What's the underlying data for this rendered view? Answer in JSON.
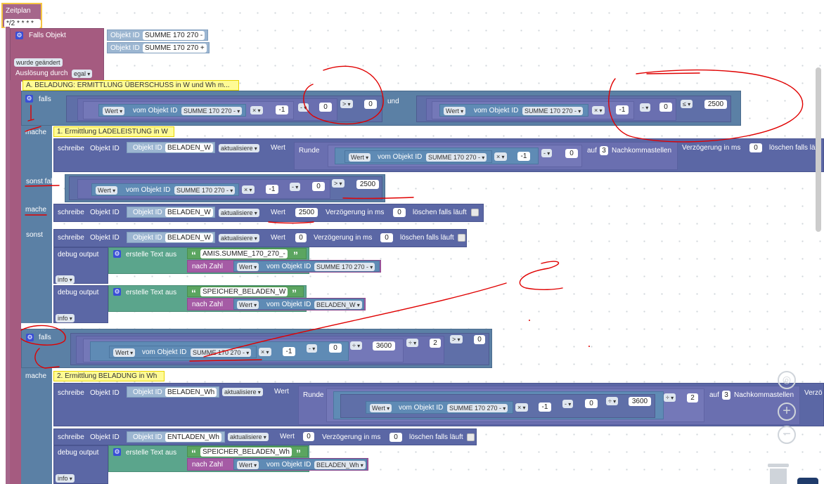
{
  "schedule": {
    "label": "Zeitplan",
    "cron": "*/2 * * * *"
  },
  "trigger": {
    "title": "Falls Objekt",
    "id_label": "Objekt ID",
    "obj1": "SUMME 170 270 -",
    "obj2": "SUMME 170 270 +",
    "changed": "wurde geändert",
    "by_label": "Auslösung durch",
    "by": "egal"
  },
  "commentA": "A. BELADUNG: ERMITTLUNG ÜBERSCHUSS in W und Wh m...",
  "kw": {
    "falls": "falls",
    "mache": "mache",
    "sonst_falls": "sonst falls",
    "sonst": "sonst",
    "und": "und",
    "wert": "Wert",
    "vom_obj": "vom Objekt ID",
    "schreibe": "schreibe",
    "objekt_id": "Objekt ID",
    "aktualisiere": "aktualisiere",
    "wert2": "Wert",
    "runde": "Runde",
    "auf": "auf",
    "nachkomma": "Nachkommastellen",
    "verzoegerung": "Verzögerung in ms",
    "loeschen": "löschen falls läuft",
    "debug": "debug output",
    "erstelle": "erstelle Text aus",
    "nach_zahl": "nach Zahl",
    "info": "info",
    "verz_cut": "Verzö",
    "loeschen_cut": "löschen falls läu"
  },
  "ops": {
    "mult": "×",
    "minus": "-",
    "gt": ">",
    "le": "≤",
    "div": "÷"
  },
  "nums": {
    "m1": "-1",
    "z": "0",
    "n2500": "2500",
    "n3": "3",
    "n3600": "3600",
    "n2": "2"
  },
  "objs": {
    "summe_minus": "SUMME 170 270 -",
    "beladen_w": "BELADEN_W",
    "beladen_wh": "BELADEN_Wh",
    "entladen_wh": "ENTLADEN_Wh"
  },
  "comment1": "1. Ermittlung LADELEISTUNG in W",
  "comment2": "2. Ermittlung BELADUNG in Wh",
  "strings": {
    "amis": "AMIS.SUMME_170_270_-",
    "speicher_w": "SPEICHER_BELADEN_W",
    "speicher_wh": "SPEICHER_BELADEN_Wh"
  },
  "icons": [
    "gear-icon",
    "zoom-in-icon",
    "zoom-out-icon",
    "reset-view-icon",
    "trash-icon"
  ],
  "colors": {
    "trigger": "#a55b80",
    "control": "#5b80a5",
    "action": "#5b67a5",
    "text": "#5ba58c",
    "annotation": "#e00000"
  }
}
